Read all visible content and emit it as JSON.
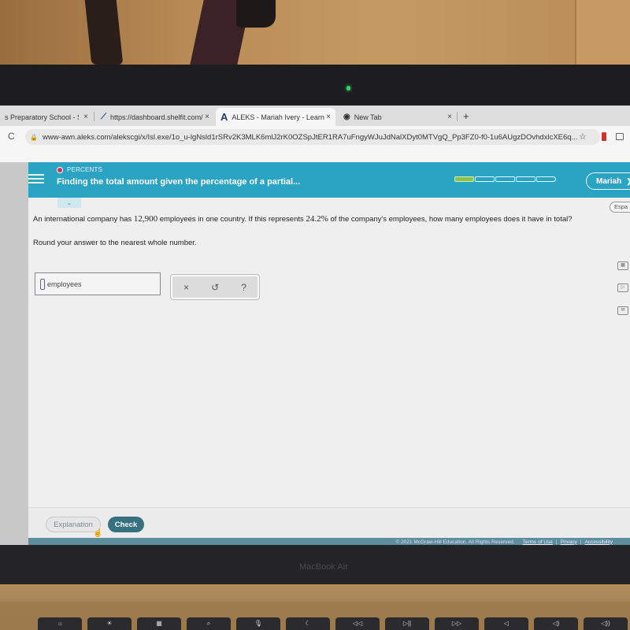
{
  "browser": {
    "tabs": [
      {
        "label": "s Preparatory School - Sign",
        "icon": "school-favicon-icon",
        "active": false
      },
      {
        "label": "https://dashboard.shelfit.com/",
        "icon": "shelfit-favicon-icon",
        "active": false
      },
      {
        "label": "ALEKS - Mariah Ivery - Learn",
        "icon": "aleks-favicon-icon",
        "favicon_glyph": "A",
        "active": true
      },
      {
        "label": "New Tab",
        "icon": "chrome-favicon-icon",
        "active": false
      }
    ],
    "close_glyph": "×",
    "new_tab_glyph": "+",
    "url": "www-awn.aleks.com/alekscgi/x/Isl.exe/1o_u-lgNsld1rSRv2K3MLK6mlJ2rK0OZSpJtER1RA7uFngyWJuJdNalXDyt0MTVgQ_Pp3FZ0-f0-1u6AUgzDOvhdxlcXE6q...",
    "reload_glyph": "C",
    "star_glyph": "☆"
  },
  "aleks": {
    "topic_label": "PERCENTS",
    "topic_title": "Finding the total amount given the percentage of a partial...",
    "progress": {
      "filled": 1,
      "total": 5
    },
    "user_name": "Mariah",
    "espanol_label": "Espa",
    "question": {
      "part1": "An international company has ",
      "employees_in_country": "12,900",
      "part2": " employees in one country. If this represents ",
      "percent": "24.2%",
      "part3": " of the company's employees, how many employees does it have in total?"
    },
    "instruction": "Round your answer to the nearest whole number.",
    "answer": {
      "value": "",
      "unit": "employees"
    },
    "tools": {
      "clear": "×",
      "undo": "↺",
      "help": "?"
    },
    "buttons": {
      "explanation": "Explanation",
      "check": "Check"
    },
    "footer": {
      "copyright": "© 2021 McGraw-Hill Education. All Rights Reserved.",
      "terms": "Terms of Use",
      "privacy": "Privacy",
      "accessibility": "Accessibility",
      "separator": "|"
    },
    "colors": {
      "header": "#2ba3c3",
      "check_button": "#37707e",
      "progress_fill": "#8bc34a",
      "topic_dot": "#d52b4c"
    }
  },
  "device": {
    "brand": "MacBook Air",
    "function_keys": [
      "☼",
      "☀",
      "▦",
      "⌕",
      "🎙",
      "☾",
      "◁◁",
      "▷||",
      "▷▷",
      "◁",
      "◁)",
      "◁))"
    ]
  }
}
